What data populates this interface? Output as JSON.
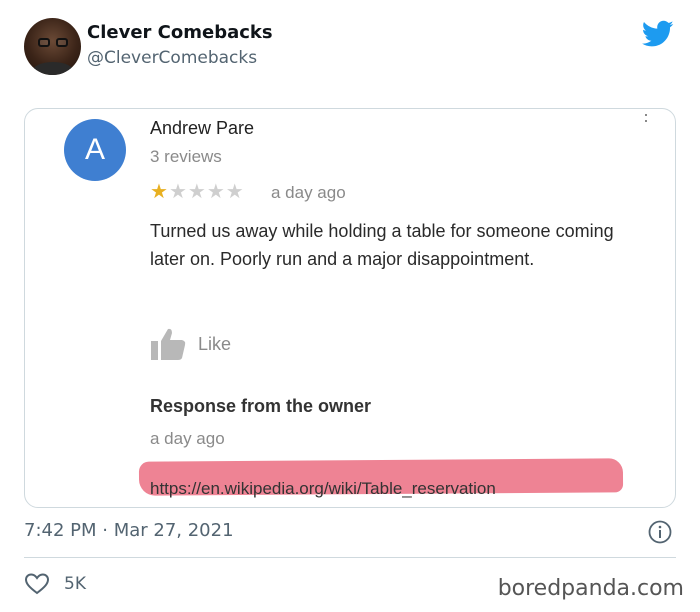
{
  "tweet": {
    "display_name": "Clever Comebacks",
    "handle": "@CleverComebacks",
    "timestamp": "7:42 PM · Mar 27, 2021",
    "like_count": "5K"
  },
  "review": {
    "avatar_letter": "A",
    "avatar_color": "#3f7fd1",
    "reviewer_name": "Andrew Pare",
    "review_count": "3 reviews",
    "rating": 1,
    "rating_max": 5,
    "age": "a day ago",
    "text": "Turned us away while holding a table for someone coming later on. Poorly run and a major disappointment.",
    "like_label": "Like",
    "owner_response": {
      "heading": "Response from the owner",
      "age": "a day ago",
      "link": "https://en.wikipedia.org/wiki/Table_reservation",
      "highlight_color": "#e96076"
    }
  },
  "watermark": "boredpanda.com",
  "colors": {
    "twitter_blue": "#1d9bf0",
    "star_on": "#e8b021",
    "star_off": "#cfcfcf"
  },
  "icons": {
    "twitter": "twitter-bird-icon",
    "more": "kebab-menu-icon",
    "thumb": "thumbs-up-icon",
    "info": "info-icon",
    "like": "heart-icon"
  }
}
